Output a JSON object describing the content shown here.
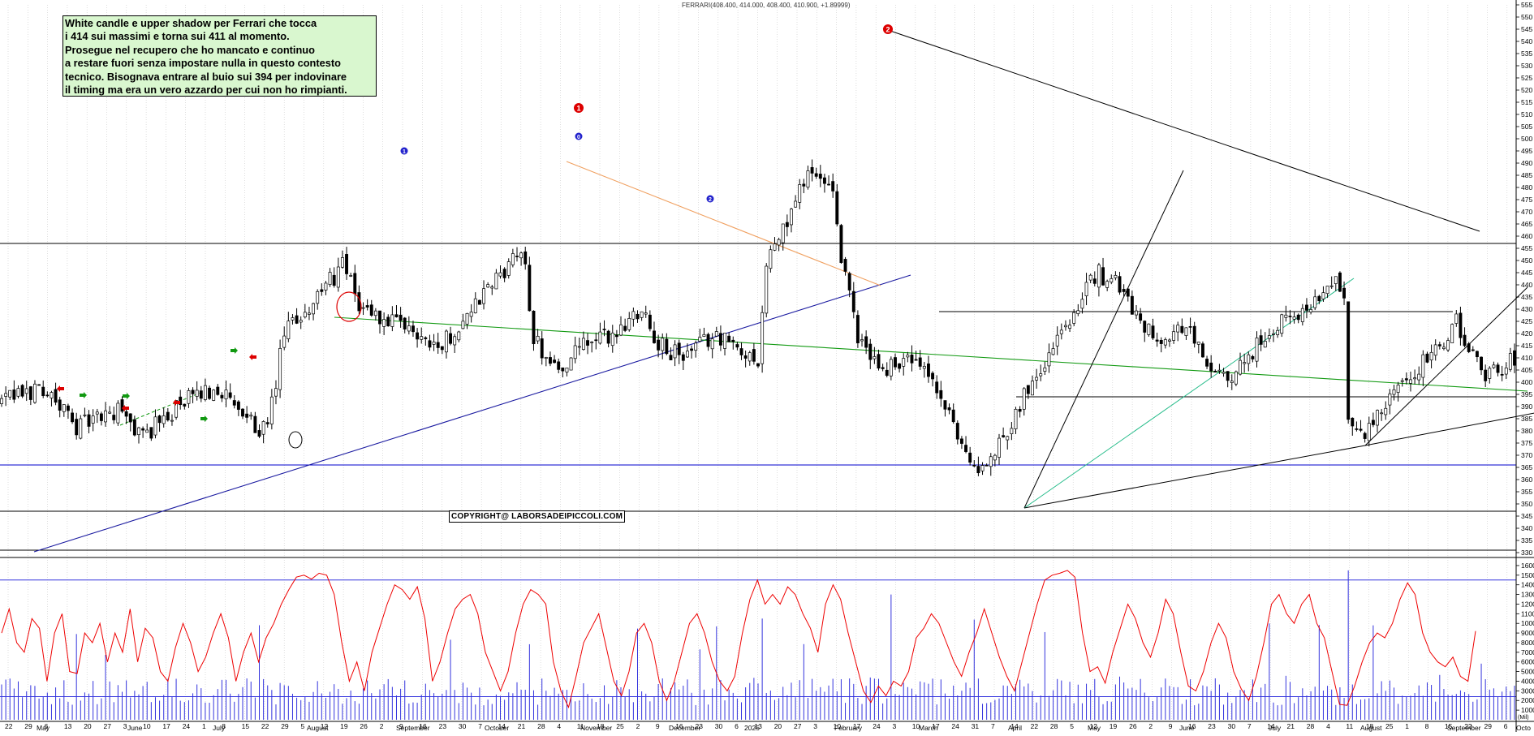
{
  "title": "FERRARI(408.400, 414.000, 408.400, 410.900, +1.89999)",
  "note_lines": [
    "White candle e upper shadow per Ferrari che tocca",
    "i 414 sui massimi e torna sui 411 al momento.",
    "Prosegue nel recupero che ho mancato e continuo",
    "a restare fuori senza impostare nulla in questo contesto",
    "tecnico. Bisognava entrare al buio sui 394  per indovinare",
    "il timing ma era un vero azzardo per cui non ho rimpianti."
  ],
  "copyright": "COPYRIGHT@ LABORSADEIPICCOLI.COM",
  "colors": {
    "candle": "#000000",
    "horizontal_blue": "#0000cc",
    "trend_blue": "#1a1aa0",
    "green_line": "#119911",
    "orange_line": "#f0a060",
    "teal_line": "#22bb88",
    "oscillator": "#ee0000",
    "volume": "#3333dd",
    "marker_red": "#dd0000",
    "marker_blue": "#2222cc",
    "note_bg": "#d9f7cf"
  },
  "markers": [
    {
      "label": "1",
      "color": "red",
      "date_index": 126,
      "price": 466
    },
    {
      "label": "2",
      "color": "red",
      "date_index": 183,
      "price": 497
    },
    {
      "label": "1",
      "color": "blue",
      "date_index": 89,
      "price": 458
    },
    {
      "label": "0",
      "color": "blue",
      "date_index": 126,
      "price": 461
    },
    {
      "label": "2",
      "color": "blue",
      "date_index": 155,
      "price": 445
    }
  ],
  "chart_data": [
    {
      "type": "candlestick",
      "title": "FERRARI(408.400, 414.000, 408.400, 410.900, +1.89999)",
      "ylim": [
        329,
        555
      ],
      "price_ticks": [
        330,
        335,
        340,
        345,
        350,
        355,
        360,
        365,
        370,
        375,
        380,
        385,
        390,
        395,
        400,
        405,
        410,
        415,
        420,
        425,
        430,
        435,
        440,
        445,
        450,
        455,
        460,
        465,
        470,
        475,
        480,
        485,
        490,
        495,
        500,
        505,
        510,
        515,
        520,
        525,
        530,
        535,
        540,
        545,
        550,
        555
      ],
      "price_path": [
        [
          0,
          392
        ],
        [
          10,
          398
        ],
        [
          18,
          382
        ],
        [
          28,
          388
        ],
        [
          34,
          378
        ],
        [
          44,
          392
        ],
        [
          52,
          398
        ],
        [
          58,
          385
        ],
        [
          64,
          380
        ],
        [
          68,
          420
        ],
        [
          76,
          435
        ],
        [
          82,
          448
        ],
        [
          86,
          432
        ],
        [
          92,
          425
        ],
        [
          100,
          420
        ],
        [
          106,
          415
        ],
        [
          112,
          428
        ],
        [
          118,
          440
        ],
        [
          124,
          452
        ],
        [
          126,
          448
        ],
        [
          128,
          418
        ],
        [
          134,
          405
        ],
        [
          140,
          415
        ],
        [
          148,
          420
        ],
        [
          154,
          432
        ],
        [
          158,
          415
        ],
        [
          164,
          410
        ],
        [
          172,
          420
        ],
        [
          178,
          412
        ],
        [
          182,
          410
        ],
        [
          184,
          448
        ],
        [
          190,
          470
        ],
        [
          194,
          488
        ],
        [
          198,
          480
        ],
        [
          200,
          475
        ],
        [
          202,
          452
        ],
        [
          206,
          418
        ],
        [
          212,
          405
        ],
        [
          218,
          410
        ],
        [
          224,
          400
        ],
        [
          228,
          385
        ],
        [
          232,
          372
        ],
        [
          236,
          362
        ],
        [
          240,
          375
        ],
        [
          246,
          395
        ],
        [
          252,
          412
        ],
        [
          258,
          430
        ],
        [
          264,
          445
        ],
        [
          270,
          438
        ],
        [
          274,
          425
        ],
        [
          280,
          418
        ],
        [
          286,
          422
        ],
        [
          290,
          405
        ],
        [
          296,
          400
        ],
        [
          302,
          415
        ],
        [
          308,
          425
        ],
        [
          314,
          430
        ],
        [
          320,
          442
        ],
        [
          323,
          438
        ],
        [
          324,
          385
        ],
        [
          328,
          378
        ],
        [
          334,
          392
        ],
        [
          340,
          405
        ],
        [
          346,
          415
        ],
        [
          350,
          425
        ],
        [
          354,
          410
        ],
        [
          358,
          402
        ],
        [
          362,
          408
        ],
        [
          364,
          410.9
        ]
      ],
      "horizontal_lines": [
        {
          "price": 457,
          "color": "black"
        },
        {
          "price": 429,
          "color": "black"
        },
        {
          "price": 394,
          "color": "black"
        },
        {
          "price": 366,
          "color": "blue"
        },
        {
          "price": 347,
          "color": "black"
        },
        {
          "price": 331,
          "color": "black"
        }
      ],
      "date_labels": [
        "22",
        "29",
        "6",
        "13",
        "20",
        "27",
        "3",
        "10",
        "17",
        "24",
        "1",
        "8",
        "15",
        "22",
        "29",
        "5",
        "12",
        "19",
        "26",
        "2",
        "9",
        "16",
        "23",
        "30",
        "7",
        "14",
        "21",
        "28",
        "4",
        "11",
        "18",
        "25",
        "2",
        "9",
        "16",
        "23",
        "30",
        "6",
        "13",
        "20",
        "27",
        "3",
        "10",
        "17",
        "24",
        "3",
        "10",
        "17",
        "24",
        "31",
        "7",
        "14",
        "22",
        "28",
        "5",
        "12",
        "19",
        "26",
        "2",
        "9",
        "16",
        "23",
        "30",
        "7",
        "14",
        "21",
        "28",
        "4",
        "11",
        "18",
        "25",
        "1",
        "8",
        "15",
        "22",
        "29",
        "6"
      ],
      "month_labels": [
        "May",
        "June",
        "July",
        "August",
        "September",
        "October",
        "November",
        "December",
        "2025",
        "February",
        "March",
        "April",
        "May",
        "June",
        "July",
        "August",
        "September",
        "Octo"
      ]
    },
    {
      "type": "bar",
      "series_name": "volume",
      "ylim": [
        0,
        16500
      ],
      "volume_ticks": [
        1000,
        2000,
        3000,
        4000,
        5000,
        6000,
        7000,
        8000,
        9000,
        10000,
        11000,
        12000,
        13000,
        14000,
        15000,
        16000
      ],
      "reference_lines": [
        14500,
        2400
      ],
      "unit_label": "(Mil)"
    },
    {
      "type": "line",
      "series_name": "oscillator",
      "values": [
        9000,
        11500,
        8000,
        7000,
        10500,
        9500,
        4000,
        9000,
        11000,
        5000,
        4800,
        9000,
        8000,
        10000,
        6000,
        9000,
        7000,
        11500,
        6000,
        9500,
        8500,
        5000,
        4000,
        7500,
        10000,
        8000,
        5000,
        6500,
        9000,
        11000,
        8500,
        4000,
        7000,
        9000,
        6000,
        8500,
        10000,
        12000,
        13500,
        14800,
        15000,
        14600,
        15200,
        15000,
        13000,
        8000,
        4000,
        6000,
        3000,
        7000,
        9500,
        12000,
        14000,
        13500,
        12500,
        13800,
        10500,
        4000,
        6000,
        9000,
        11500,
        12500,
        13000,
        11000,
        7000,
        5000,
        3000,
        5000,
        9000,
        12000,
        13500,
        13000,
        12000,
        6000,
        3000,
        1300,
        4500,
        8000,
        9500,
        11000,
        7500,
        4000,
        2500,
        5000,
        9000,
        10000,
        8000,
        4000,
        2000,
        4000,
        7000,
        10000,
        11000,
        9000,
        6000,
        4000,
        3000,
        4500,
        9000,
        12500,
        14500,
        12000,
        13000,
        12000,
        13800,
        13000,
        11000,
        9500,
        7000,
        12000,
        14000,
        12500,
        9000,
        6000,
        3000,
        1800,
        3500,
        2500,
        4000,
        3500,
        5000,
        8500,
        9500,
        11000,
        10000,
        8000,
        6000,
        4500,
        7000,
        9000,
        11500,
        9000,
        6500,
        4500,
        3000,
        6000,
        9000,
        12000,
        14500,
        15000,
        15200,
        15500,
        14800,
        9000,
        5000,
        5500,
        3800,
        7000,
        9500,
        12000,
        10500,
        8000,
        6500,
        9000,
        12500,
        11000,
        7000,
        3500,
        3000,
        5000,
        8000,
        10000,
        8500,
        5000,
        3200,
        2000,
        4500,
        8000,
        12000,
        13000,
        11000,
        10000,
        12000,
        13000,
        10000,
        8500,
        5000,
        1600,
        1500,
        3500,
        6000,
        8000,
        9000,
        8500,
        10000,
        12500,
        14200,
        13000,
        9000,
        7000,
        6000,
        5500,
        6500,
        4500,
        4000,
        9200
      ]
    }
  ]
}
